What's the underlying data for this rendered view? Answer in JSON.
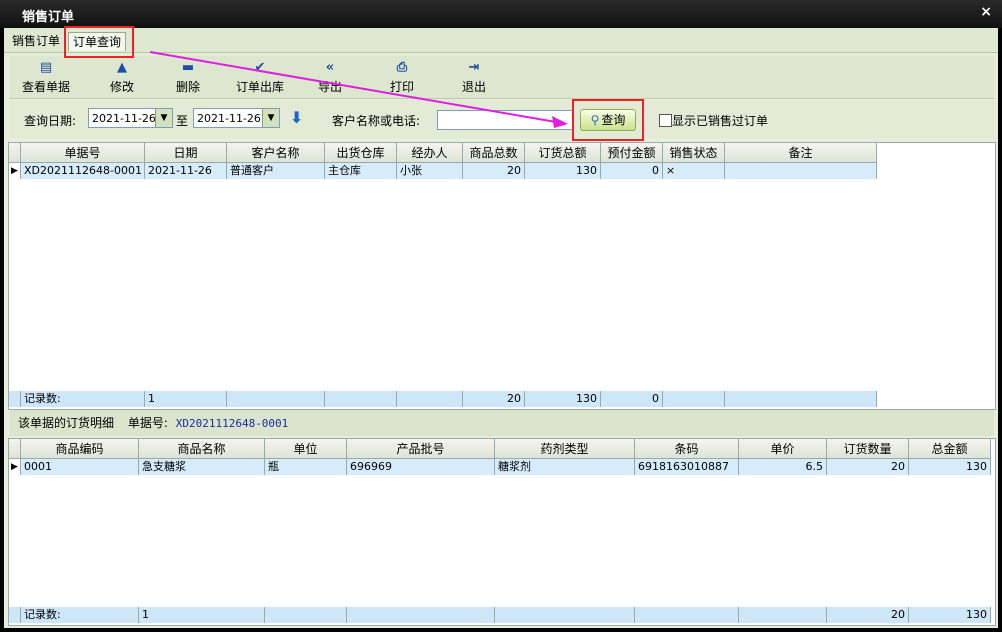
{
  "window": {
    "title": "销售订单",
    "close": "×"
  },
  "tabs": [
    {
      "label": "销售订单"
    },
    {
      "label": "订单查询"
    }
  ],
  "toolbar": [
    {
      "label": "查看单据",
      "icon": "view-icon"
    },
    {
      "label": "修改",
      "icon": "up-triangle-icon"
    },
    {
      "label": "删除",
      "icon": "minus-icon"
    },
    {
      "label": "订单出库",
      "icon": "check-icon"
    },
    {
      "label": "导出",
      "icon": "double-left-icon"
    },
    {
      "label": "打印",
      "icon": "printer-icon"
    },
    {
      "label": "退出",
      "icon": "exit-icon"
    }
  ],
  "query": {
    "date_label": "查询日期:",
    "date_from": "2021-11-26",
    "to_label": "至",
    "date_to": "2021-11-26",
    "customer_label": "客户名称或电话:",
    "customer_value": "",
    "search_label": "查询",
    "show_sold_label": "显示已销售过订单"
  },
  "orders": {
    "columns": [
      "单据号",
      "日期",
      "客户名称",
      "出货仓库",
      "经办人",
      "商品总数",
      "订货总额",
      "预付金额",
      "销售状态",
      "备注"
    ],
    "rows": [
      [
        "XD2021112648-0001",
        "2021-11-26",
        "普通客户",
        "主仓库",
        "小张",
        "20",
        "130",
        "0",
        "×",
        ""
      ]
    ],
    "footer": [
      "记录数:",
      "1",
      "",
      "",
      "",
      "20",
      "130",
      "0",
      "",
      ""
    ]
  },
  "detail_header": {
    "label": "该单据的订货明细",
    "doc_label": "单据号:",
    "doc_no": "XD2021112648-0001"
  },
  "details": {
    "columns": [
      "商品编码",
      "商品名称",
      "单位",
      "产品批号",
      "药剂类型",
      "条码",
      "单价",
      "订货数量",
      "总金额"
    ],
    "rows": [
      [
        "0001",
        "急支糖浆",
        "瓶",
        "696969",
        "糖浆剂",
        "6918163010887",
        "6.5",
        "20",
        "130"
      ]
    ],
    "footer": [
      "记录数:",
      "1",
      "",
      "",
      "",
      "",
      "",
      "20",
      "130"
    ]
  },
  "colors": {
    "accent": "#e22222",
    "arrow": "#e01ee0",
    "selected_row": "#d6ecfb"
  }
}
